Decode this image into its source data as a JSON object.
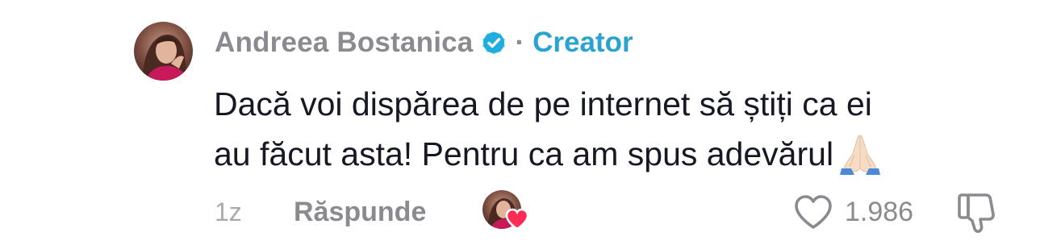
{
  "comment": {
    "author": {
      "name": "Andreea Bostanica",
      "verified": true,
      "separator": "·",
      "role_label": "Creator",
      "role_color": "#2aa3cf",
      "avatar_icon": "avatar"
    },
    "text_lines": [
      "Dacă voi dispărea de pe internet să știți ca ei",
      "au făcut asta! Pentru ca am spus adevărul"
    ],
    "emoji_icon": "praying-hands-icon",
    "timestamp": "1z",
    "reply_label": "Răspunde",
    "creator_liked": true,
    "like_count": "1.986",
    "like_icon": "heart-outline-icon",
    "dislike_icon": "thumbs-down-icon"
  }
}
